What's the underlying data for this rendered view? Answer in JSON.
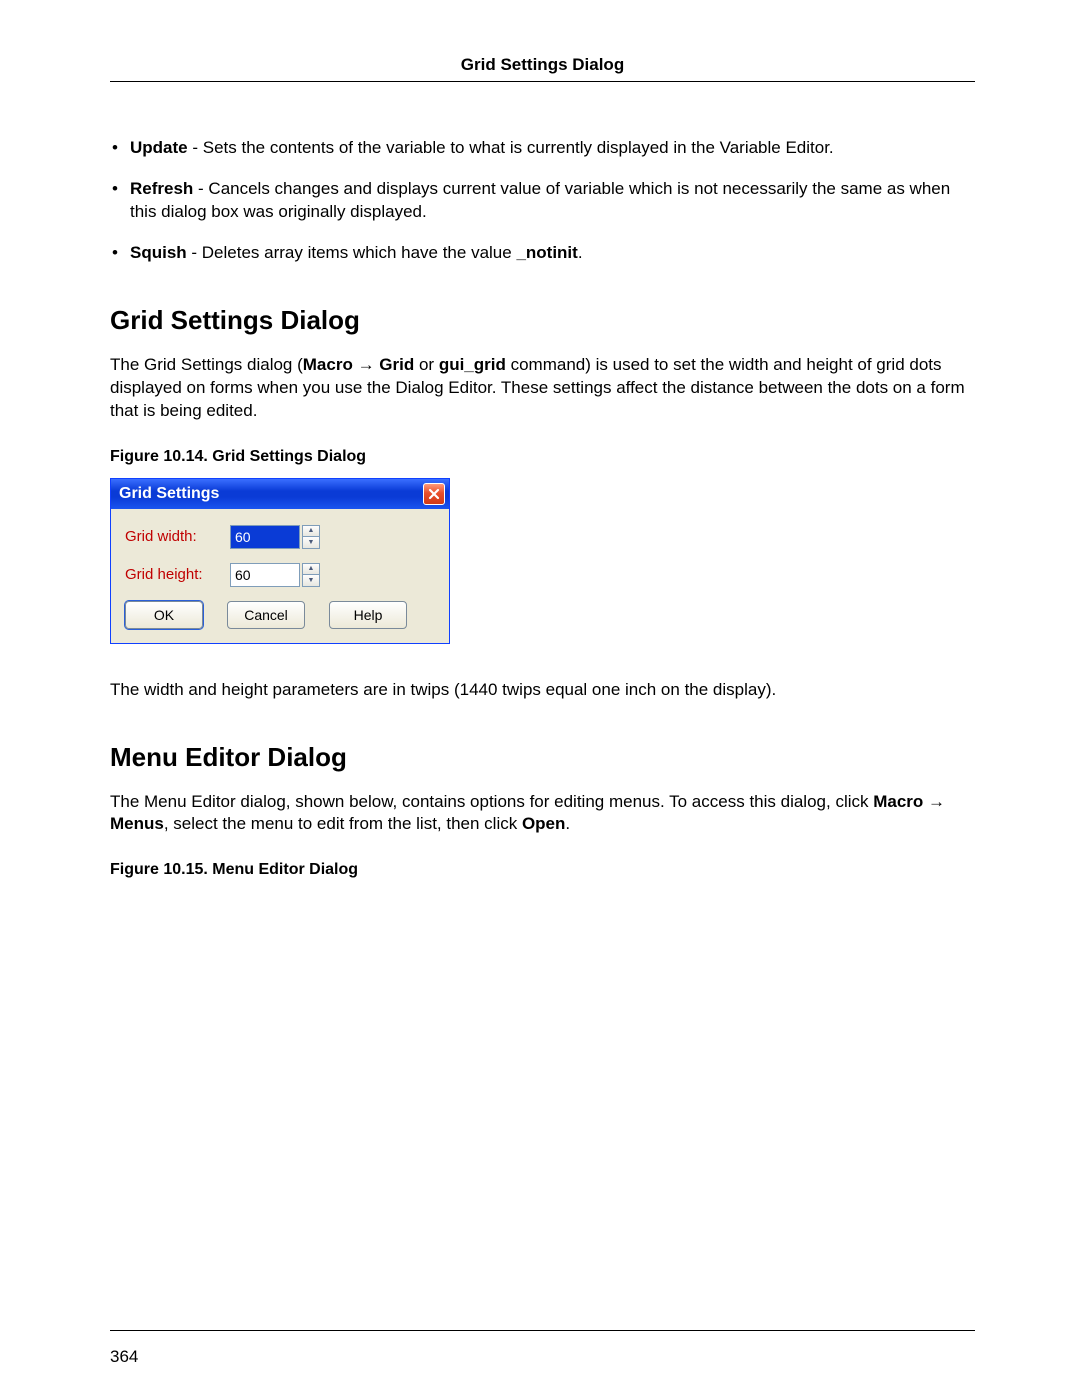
{
  "header": {
    "title": "Grid Settings Dialog"
  },
  "bullets": [
    {
      "term": "Update",
      "text": " - Sets the contents of the variable to what is currently displayed in the Variable Editor."
    },
    {
      "term": "Refresh",
      "text": " - Cancels changes and displays current value of variable which is not necessarily the same as when this dialog box was originally displayed."
    },
    {
      "term": "Squish",
      "text_pre": " - Deletes array items which have the value ",
      "code": "_notinit",
      "text_post": "."
    }
  ],
  "section1": {
    "heading": "Grid Settings Dialog",
    "para_parts": {
      "p1": "The Grid Settings dialog (",
      "b1": "Macro",
      "arrow": " → ",
      "b2": "Grid",
      "p2": " or ",
      "b3": "gui_grid",
      "p3": " command) is used to set the width and height of grid dots displayed on forms when you use the Dialog Editor. These settings affect the distance between the dots on a form that is being edited."
    },
    "fig_caption": "Figure 10.14.  Grid Settings Dialog",
    "after_fig": "The width and height parameters are in twips (1440 twips equal one inch on the display)."
  },
  "dialog": {
    "title": "Grid Settings",
    "width_label": "Grid width:",
    "height_label": "Grid height:",
    "width_value": "60",
    "height_value": "60",
    "ok": "OK",
    "cancel": "Cancel",
    "help": "Help"
  },
  "section2": {
    "heading": "Menu Editor Dialog",
    "para_parts": {
      "p1": "The Menu Editor dialog, shown below, contains options for editing menus. To access this dialog, click ",
      "b1": "Macro",
      "arrow": " → ",
      "b2": "Menus",
      "p2": ", select the menu to edit from the list, then click ",
      "b3": "Open",
      "p3": "."
    },
    "fig_caption": "Figure 10.15.  Menu Editor Dialog"
  },
  "page_number": "364"
}
